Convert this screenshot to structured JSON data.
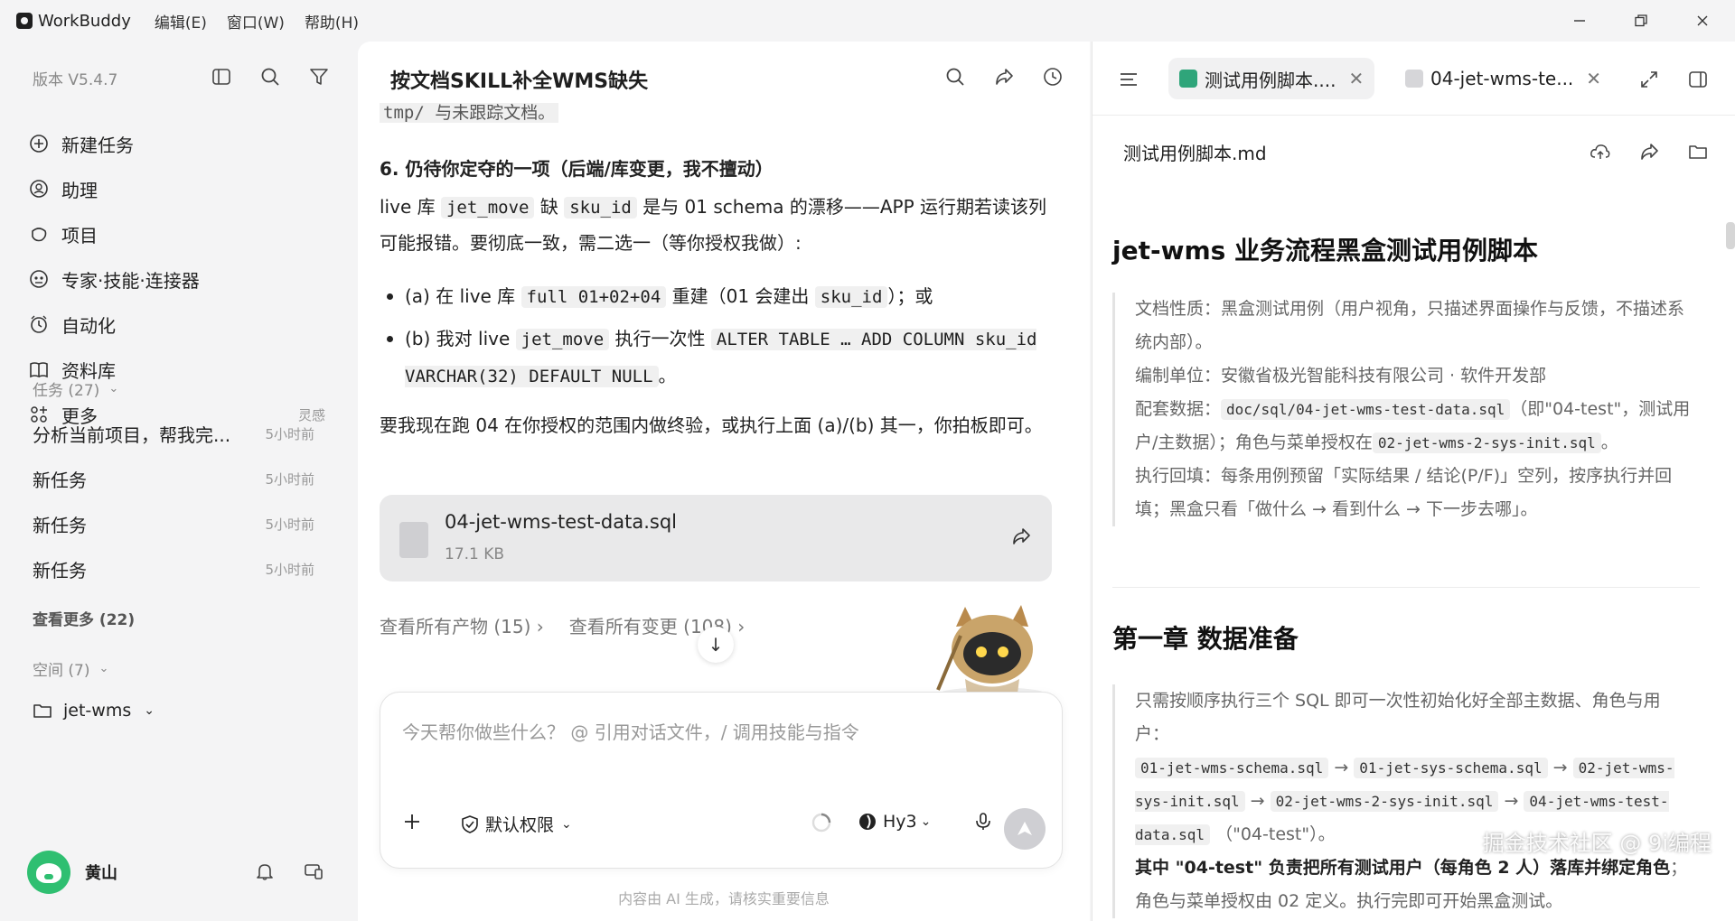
{
  "titlebar": {
    "app_name": "WorkBuddy",
    "menus": [
      "编辑(E)",
      "窗口(W)",
      "帮助(H)"
    ]
  },
  "sidebar": {
    "version": "版本 V5.4.7",
    "nav": [
      {
        "label": "新建任务",
        "icon": "new-task-icon"
      },
      {
        "label": "助理",
        "icon": "assistant-icon"
      },
      {
        "label": "项目",
        "icon": "project-icon"
      },
      {
        "label": "专家·技能·连接器",
        "icon": "expert-icon"
      },
      {
        "label": "自动化",
        "icon": "automation-icon"
      },
      {
        "label": "资料库",
        "icon": "library-icon"
      },
      {
        "label": "更多",
        "icon": "more-icon",
        "hint": "灵感"
      }
    ],
    "tasks_header": "任务 (27)",
    "tasks": [
      {
        "title": "分析当前项目，帮我完...",
        "time": "5小时前"
      },
      {
        "title": "新任务",
        "time": "5小时前"
      },
      {
        "title": "新任务",
        "time": "5小时前"
      },
      {
        "title": "新任务",
        "time": "5小时前"
      }
    ],
    "view_more": "查看更多 (22)",
    "spaces_header": "空间 (7)",
    "space": "jet-wms",
    "user_name": "黄山"
  },
  "chat": {
    "title": "按文档SKILL补全WMS缺失",
    "top_partial": "tmp/ 与未跟踪文档。",
    "section_heading": "6. 仍待你定夺的一项（后端/库变更，我不擅动）",
    "para1_a": "live 库 ",
    "para1_code1": "jet_move",
    "para1_b": " 缺 ",
    "para1_code2": "sku_id",
    "para1_c": " 是与 01 schema 的漂移——APP 运行期若读该列可能报错。要彻底一致，需二选一（等你授权我做）:",
    "bullet1_a": "(a) 在 live 库 ",
    "bullet1_code": "full 01+02+04",
    "bullet1_b": " 重建（01 会建出 ",
    "bullet1_code2": "sku_id",
    "bullet1_c": "）；或",
    "bullet2_a": "(b) 我对 live ",
    "bullet2_code": "jet_move",
    "bullet2_b": " 执行一次性 ",
    "bullet2_code2": "ALTER TABLE … ADD COLUMN sku_id VARCHAR(32) DEFAULT NULL",
    "bullet2_c": "。",
    "para2": "要我现在跑 04 在你授权的范围内做终验，或执行上面 (a)/(b) 其一，你拍板即可。",
    "file_name": "04-jet-wms-test-data.sql",
    "file_size": "17.1 KB",
    "link_artifacts": "查看所有产物 (15)",
    "link_changes": "查看所有变更 (108)",
    "composer_placeholder": "今天帮你做些什么？ @ 引用对话文件，/ 调用技能与指令",
    "permission": "默认权限",
    "model": "Hy3",
    "disclaimer": "内容由 AI 生成，请核实重要信息"
  },
  "right": {
    "tab1": "测试用例脚本....",
    "tab2": "04-jet-wms-te...",
    "doc_filename": "测试用例脚本.md",
    "h1": "jet-wms 业务流程黑盒测试用例脚本",
    "q1_l1": "文档性质：黑盒测试用例（用户视角，只描述界面操作与反馈，不描述系统内部）。",
    "q1_l2": "编制单位：安徽省极光智能科技有限公司 · 软件开发部",
    "q1_l3a": "配套数据：",
    "q1_l3code": "doc/sql/04-jet-wms-test-data.sql",
    "q1_l3b": "（即\"04-test\"，测试用户/主数据）；角色与菜单授权在",
    "q1_l3code2": "02-jet-wms-2-sys-init.sql",
    "q1_l3c": "。",
    "q1_l4": "执行回填：每条用例预留「实际结果 / 结论(P/F)」空列，按序执行并回填；黑盒只看「做什么 → 看到什么 → 下一步去哪」。",
    "h2": "第一章 数据准备",
    "q2_l1": "只需按顺序执行三个 SQL 即可一次性初始化好全部主数据、角色与用户：",
    "q2_files": [
      "01-jet-wms-schema.sql",
      "01-jet-sys-schema.sql",
      "02-jet-wms-sys-init.sql",
      "02-jet-wms-2-sys-init.sql",
      "04-jet-wms-test-data.sql"
    ],
    "q2_tail": "（\"04-test\"）。",
    "q2_l3a": "其中 \"04-test\" 负责把所有测试用户（每角色 2 人）落库并绑定角色",
    "q2_l3b": "；角色与菜单授权由 02 定义。执行完即可开始黑盒测试。"
  },
  "watermark": "掘金技术社区 @ 9i编程"
}
